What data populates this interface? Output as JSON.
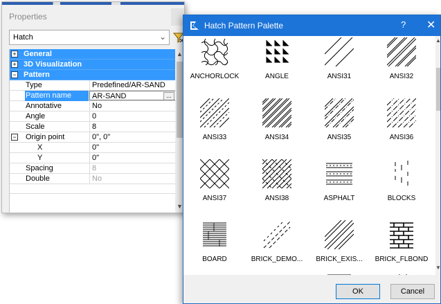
{
  "properties": {
    "title": "Properties",
    "object_type": "Hatch",
    "categories": {
      "general": "General",
      "viz": "3D Visualization",
      "pattern": "Pattern"
    },
    "rows": {
      "type": {
        "name": "Type",
        "value": "Predefined/AR-SAND"
      },
      "pattern_name": {
        "name": "Pattern name",
        "value": "AR-SAND"
      },
      "annotative": {
        "name": "Annotative",
        "value": "No"
      },
      "angle": {
        "name": "Angle",
        "value": "0"
      },
      "scale": {
        "name": "Scale",
        "value": "8"
      },
      "origin": {
        "name": "Origin point",
        "value": "0\", 0\""
      },
      "x": {
        "name": "X",
        "value": "0\""
      },
      "y": {
        "name": "Y",
        "value": "0\""
      },
      "spacing": {
        "name": "Spacing",
        "value": "8"
      },
      "double": {
        "name": "Double",
        "value": "No"
      }
    },
    "expand_plus": "+",
    "expand_minus": "−",
    "dots": "...",
    "icons": {
      "filter": "quick-select-filter-icon",
      "chevron": "chevron-down-icon"
    }
  },
  "palette": {
    "title": "Hatch Pattern Palette",
    "help": "?",
    "close": "✕",
    "patterns": [
      "ANCHORLOCK",
      "ANGLE",
      "ANSI31",
      "ANSI32",
      "ANSI33",
      "ANSI34",
      "ANSI35",
      "ANSI36",
      "ANSI37",
      "ANSI38",
      "ASPHALT",
      "BLOCKS",
      "BOARD",
      "BRICK_DEMO...",
      "BRICK_EXIS...",
      "BRICK_FLBOND"
    ],
    "ok": "OK",
    "cancel": "Cancel",
    "icons": {
      "app": "bricscad-app-icon"
    }
  }
}
